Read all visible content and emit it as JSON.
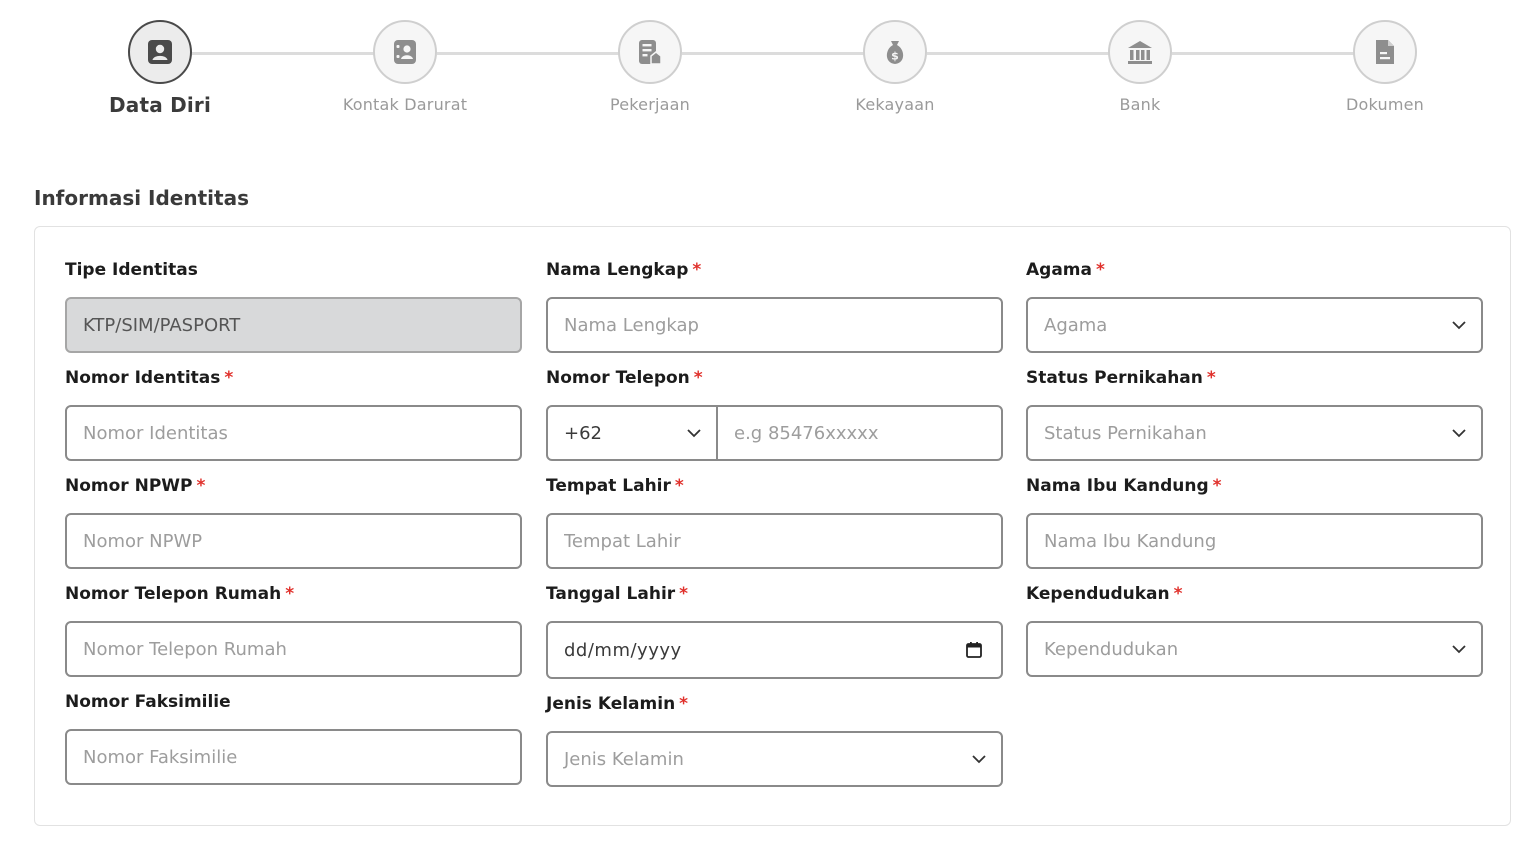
{
  "stepper": {
    "steps": [
      {
        "label": "Data Diri",
        "icon": "user-icon",
        "active": true
      },
      {
        "label": "Kontak Darurat",
        "icon": "contact-card-icon",
        "active": false
      },
      {
        "label": "Pekerjaan",
        "icon": "office-building-icon",
        "active": false
      },
      {
        "label": "Kekayaan",
        "icon": "money-bag-icon",
        "active": false
      },
      {
        "label": "Bank",
        "icon": "bank-icon",
        "active": false
      },
      {
        "label": "Dokumen",
        "icon": "document-icon",
        "active": false
      }
    ]
  },
  "section": {
    "title": "Informasi Identitas"
  },
  "colors": {
    "required": "#e0312c",
    "border": "#8a8a8a",
    "disabled_bg": "#d8d9da"
  },
  "form": {
    "tipe_identitas": {
      "label": "Tipe Identitas",
      "value": "KTP/SIM/PASPORT"
    },
    "nama_lengkap": {
      "label": "Nama Lengkap",
      "placeholder": "Nama Lengkap"
    },
    "agama": {
      "label": "Agama",
      "placeholder": "Agama"
    },
    "nomor_identitas": {
      "label": "Nomor Identitas",
      "placeholder": "Nomor Identitas"
    },
    "nomor_telepon": {
      "label": "Nomor Telepon",
      "code": "+62",
      "placeholder": "e.g 85476xxxxx"
    },
    "status_pernikahan": {
      "label": "Status Pernikahan",
      "placeholder": "Status Pernikahan"
    },
    "nomor_npwp": {
      "label": "Nomor NPWP",
      "placeholder": "Nomor NPWP"
    },
    "tempat_lahir": {
      "label": "Tempat Lahir",
      "placeholder": "Tempat Lahir"
    },
    "nama_ibu": {
      "label": "Nama Ibu Kandung",
      "placeholder": "Nama Ibu Kandung"
    },
    "telepon_rumah": {
      "label": "Nomor Telepon Rumah",
      "placeholder": "Nomor Telepon Rumah"
    },
    "tanggal_lahir": {
      "label": "Tanggal Lahir",
      "placeholder": "dd/mm/yyyy"
    },
    "kependudukan": {
      "label": "Kependudukan",
      "placeholder": "Kependudukan"
    },
    "faksimilie": {
      "label": "Nomor Faksimilie",
      "placeholder": "Nomor Faksimilie"
    },
    "jenis_kelamin": {
      "label": "Jenis Kelamin",
      "placeholder": "Jenis Kelamin"
    },
    "required_mark": "*"
  }
}
